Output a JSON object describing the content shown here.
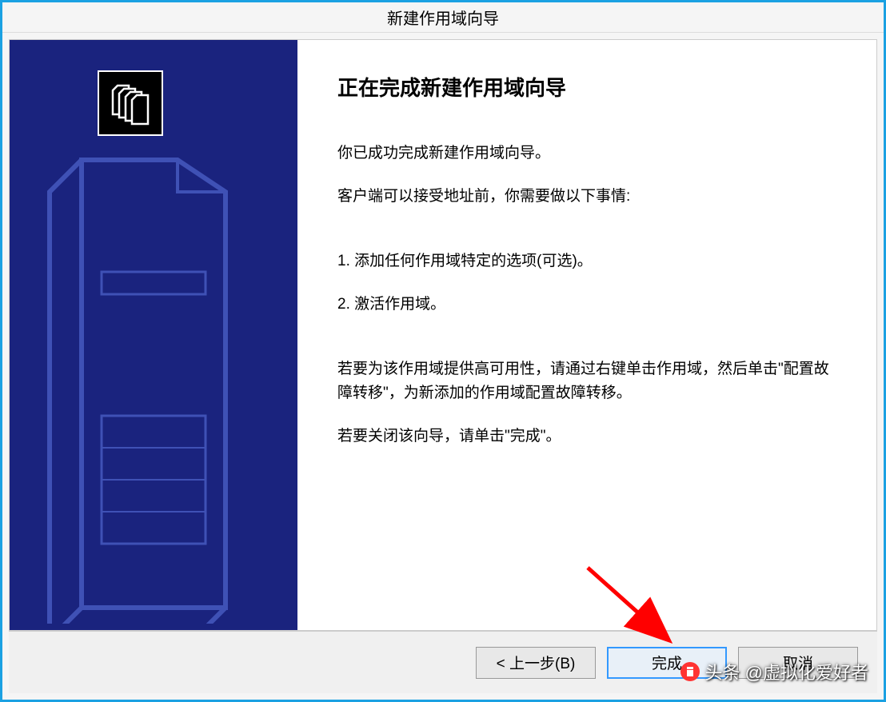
{
  "title": "新建作用域向导",
  "heading": "正在完成新建作用域向导",
  "para1": "你已成功完成新建作用域向导。",
  "para2": "客户端可以接受地址前，你需要做以下事情:",
  "step1": "1. 添加任何作用域特定的选项(可选)。",
  "step2": "2. 激活作用域。",
  "para3": "若要为该作用域提供高可用性，请通过右键单击作用域，然后单击\"配置故障转移\"，为新添加的作用域配置故障转移。",
  "para4": "若要关闭该向导，请单击\"完成\"。",
  "buttons": {
    "back": "< 上一步(B)",
    "finish": "完成",
    "cancel": "取消"
  },
  "watermark": "头条 @虚拟化爱好者"
}
